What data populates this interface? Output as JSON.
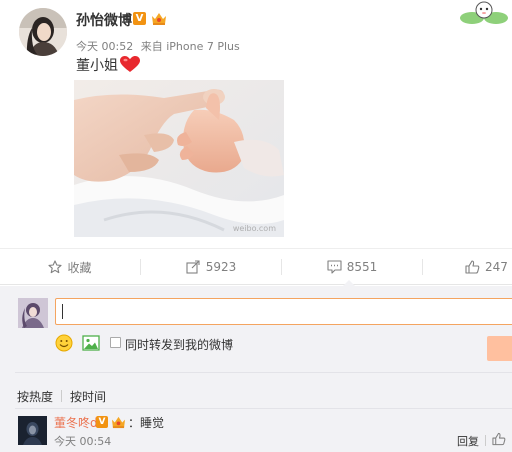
{
  "post": {
    "user_name": "孙怡微博",
    "verified_badge": "V",
    "time": "今天 00:52",
    "from_label": "来自",
    "source": "iPhone 7 Plus",
    "text": "董小姐",
    "emoji": "heart-icon",
    "image": "baby-hand-photo"
  },
  "actions": {
    "favorite_label": "收藏",
    "forward_count": "5923",
    "comment_count": "8551",
    "like_count": "247"
  },
  "comment_box": {
    "input_value": "",
    "repost_label": "同时转发到我的微博"
  },
  "sort": {
    "hot_label": "按热度",
    "time_label": "按时间"
  },
  "comments": [
    {
      "user": "董冬咚d",
      "verified_badge": "V",
      "text": "：睡觉",
      "time": "今天 00:54",
      "reply_label": "回复"
    }
  ],
  "colors": {
    "accent_orange": "#eb7350",
    "badge_orange": "#f29312",
    "input_border": "#f4a460",
    "submit_bg": "#ffc09f",
    "panel_bg": "#f2f2f5"
  }
}
